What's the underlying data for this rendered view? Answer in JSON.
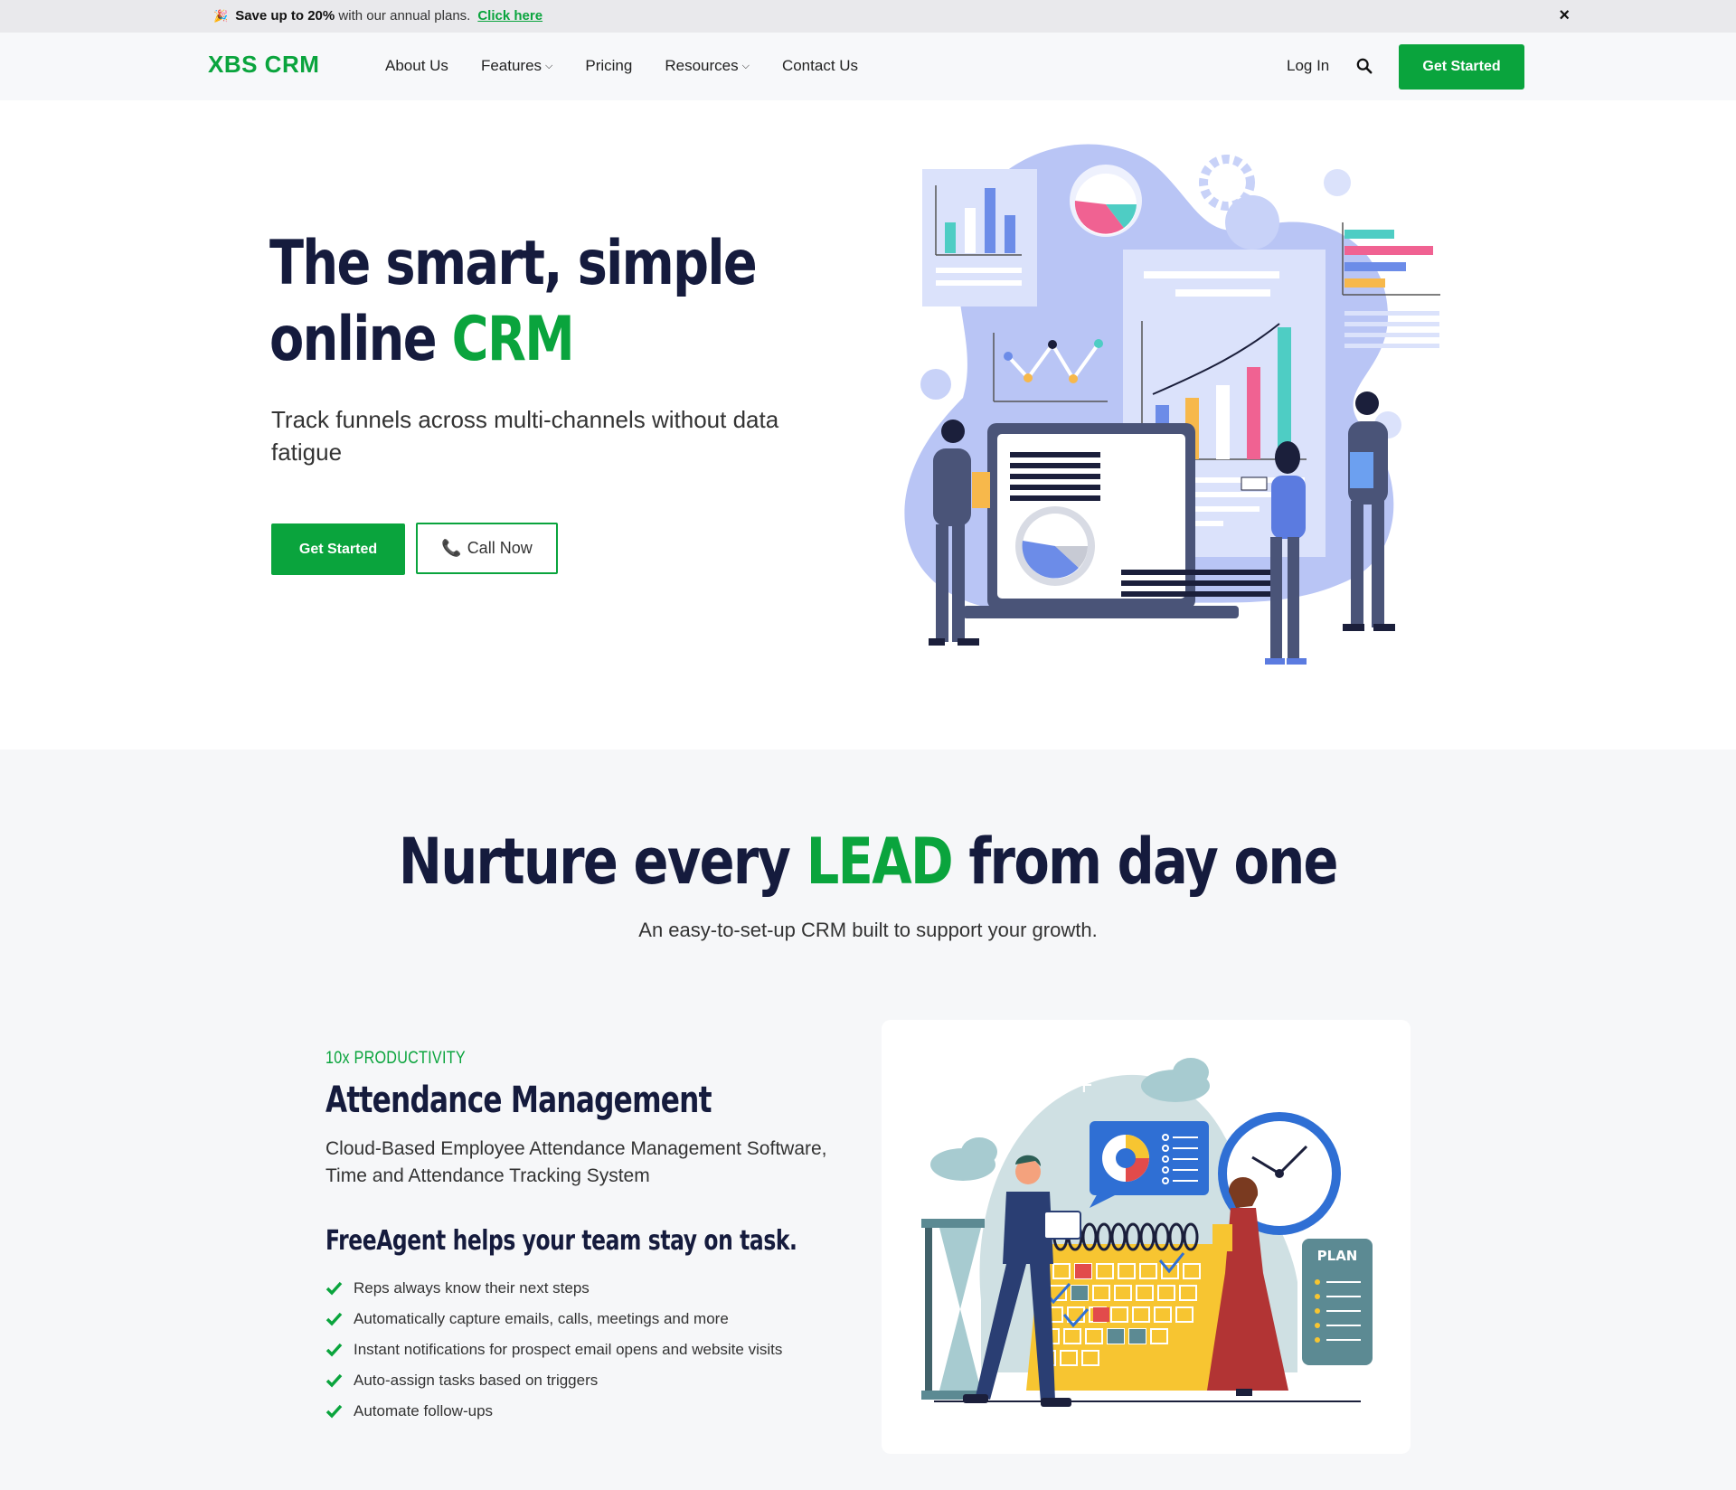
{
  "announcement": {
    "bold_text": "Save up to 20%",
    "text": "with our annual plans.",
    "link": "Click here",
    "close_icon": "×"
  },
  "header": {
    "logo": "XBS CRM",
    "nav": [
      {
        "label": "About Us",
        "dropdown": false
      },
      {
        "label": "Features",
        "dropdown": true
      },
      {
        "label": "Pricing",
        "dropdown": false
      },
      {
        "label": "Resources",
        "dropdown": true
      },
      {
        "label": "Contact Us",
        "dropdown": false
      }
    ],
    "login": "Log In",
    "cta": "Get Started"
  },
  "hero": {
    "title_line1": "The smart, simple",
    "title_line2_prefix": "online ",
    "title_line2_accent": "CRM",
    "subtitle": "Track funnels across multi-channels without data fatigue",
    "primary_button": "Get Started",
    "secondary_button": "Call Now",
    "illustration_icon": "crm-analytics-illustration"
  },
  "section2": {
    "title_prefix": "Nurture every ",
    "title_accent": "LEAD",
    "title_suffix": " from day one",
    "subtitle": "An easy-to-set-up CRM built to support your growth.",
    "feature": {
      "kicker": "10x PRODUCTIVITY",
      "title": "Attendance Management",
      "description": "Cloud-Based Employee Attendance Management Software, Time and Attendance Tracking System",
      "subheading": "FreeAgent helps your team stay on task.",
      "checklist": [
        "Reps always know their next steps",
        "Automatically capture emails, calls, meetings and more",
        "Instant notifications for prospect email opens and website visits",
        "Auto-assign tasks based on triggers",
        "Automate follow-ups"
      ],
      "illustration_icon": "calendar-planning-illustration",
      "illustration_label": "PLAN"
    }
  },
  "colors": {
    "brand_green": "#0aa43d",
    "navy": "#151b3d",
    "section_bg": "#f6f7f9"
  }
}
